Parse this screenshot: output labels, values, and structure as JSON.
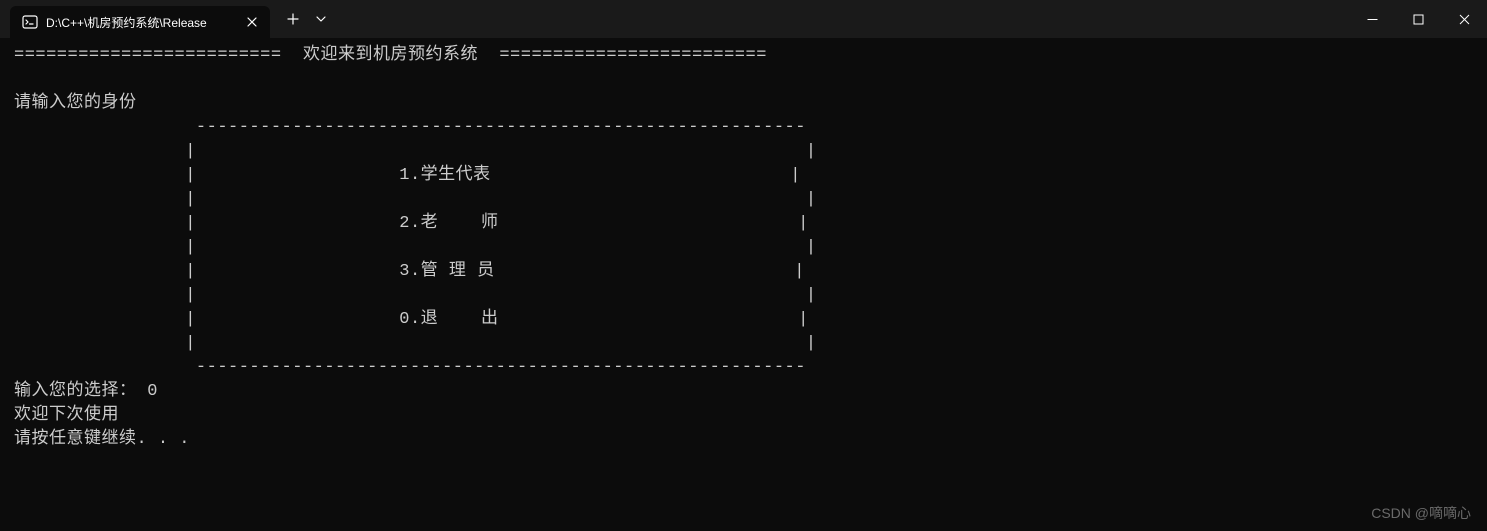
{
  "titlebar": {
    "tab_title": "D:\\C++\\机房预约系统\\Release",
    "tab_icon_name": "terminal-icon"
  },
  "terminal": {
    "header_line": "=========================  欢迎来到机房预约系统  =========================",
    "blank": "",
    "prompt_identity": "请输入您的身份",
    "box_top": "                 ---------------------------------------------------------",
    "box_side": "                |                                                         |",
    "box_opt1": "                |                   1.学生代表                            |",
    "box_opt2": "                |                   2.老    师                            |",
    "box_opt3": "                |                   3.管 理 员                            |",
    "box_opt4": "                |                   0.退    出                            |",
    "box_bottom": "                 ---------------------------------------------------------",
    "input_line": "输入您的选择： 0",
    "farewell": "欢迎下次使用",
    "continue": "请按任意键继续. . ."
  },
  "watermark": "CSDN @嘀嘀心"
}
